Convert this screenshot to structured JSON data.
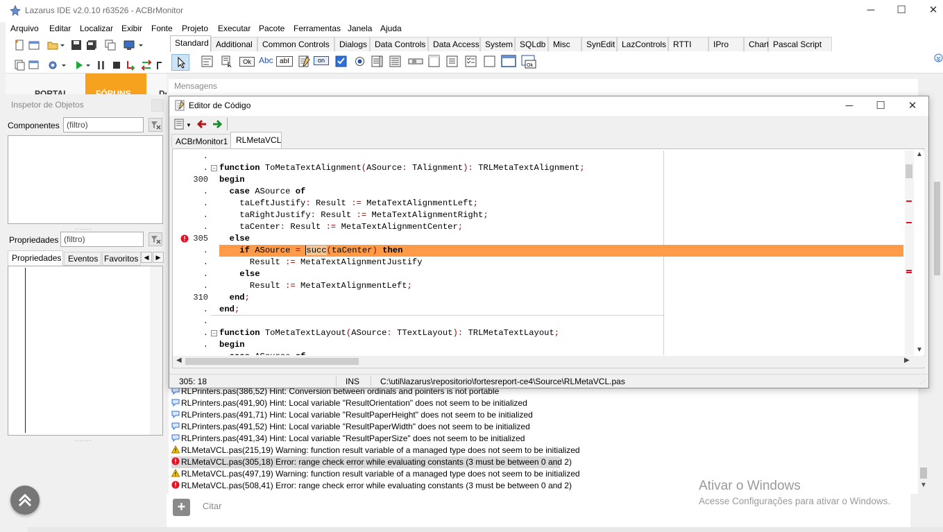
{
  "app": {
    "title": "Lazarus IDE v2.0.10 r63526 - ACBrMonitor",
    "minimize": "─",
    "maximize": "☐",
    "close": "✕"
  },
  "menu": [
    "Arquivo",
    "Editar",
    "Localizar",
    "Exibir",
    "Fonte",
    "Projeto",
    "Executar",
    "Pacote",
    "Ferramentas",
    "Janela",
    "Ajuda"
  ],
  "palette_tabs": [
    "Standard",
    "Additional",
    "Common Controls",
    "Dialogs",
    "Data Controls",
    "Data Access",
    "System",
    "SQLdb",
    "Misc",
    "SynEdit",
    "LazControls",
    "RTTI",
    "IPro",
    "Chart",
    "Pascal Script"
  ],
  "palette_components": [
    "Ok",
    "Abc",
    "abI",
    "on"
  ],
  "background": {
    "portal": "PORTAL",
    "forum": "FÓRUNS",
    "de": "De"
  },
  "inspector": {
    "title": "Inspetor de Objetos",
    "components_label": "Componentes",
    "filter_placeholder": "(filtro)",
    "props_label": "Propriedades",
    "tabs": [
      "Propriedades",
      "Eventos",
      "Favoritos"
    ]
  },
  "messages": {
    "title": "Mensagens",
    "lines": [
      {
        "type": "hint",
        "text": "RLPrinters.pas(386,52) Hint: Conversion between ordinals and pointers is not portable"
      },
      {
        "type": "hint",
        "text": "RLPrinters.pas(491,90) Hint: Local variable \"ResultOrientation\" does not seem to be initialized"
      },
      {
        "type": "hint",
        "text": "RLPrinters.pas(491,71) Hint: Local variable \"ResultPaperHeight\" does not seem to be initialized"
      },
      {
        "type": "hint",
        "text": "RLPrinters.pas(491,52) Hint: Local variable \"ResultPaperWidth\" does not seem to be initialized"
      },
      {
        "type": "hint",
        "text": "RLPrinters.pas(491,34) Hint: Local variable \"ResultPaperSize\" does not seem to be initialized"
      },
      {
        "type": "warning",
        "text": "RLMetaVCL.pas(215,19) Warning: function result variable of a managed type does not seem to be initialized"
      },
      {
        "type": "error",
        "text": "RLMetaVCL.pas(305,18) Error: range check error while evaluating constants (3 must be between 0 and 2)"
      },
      {
        "type": "warning",
        "text": "RLMetaVCL.pas(497,19) Warning: function result variable of a managed type does not seem to be initialized"
      },
      {
        "type": "error",
        "text": "RLMetaVCL.pas(508,41) Error: range check error while evaluating constants (3 must be between 0 and 2)"
      }
    ],
    "cite": "Citar"
  },
  "editor": {
    "title": "Editor de Código",
    "tabs": [
      "ACBrMonitor1",
      "RLMetaVCL"
    ],
    "active_tab": "RLMetaVCL",
    "gutter": [
      ".",
      ".",
      "300",
      ".",
      ".",
      ".",
      ".",
      "305",
      ".",
      ".",
      ".",
      ".",
      "310",
      ".",
      ".",
      ".",
      "."
    ],
    "lines": [
      "",
      "function ToMetaTextAlignment(ASource: TAlignment): TRLMetaTextAlignment;",
      "begin",
      "  case ASource of",
      "    taLeftJustify: Result := MetaTextAlignmentLeft;",
      "    taRightJustify: Result := MetaTextAlignmentRight;",
      "    taCenter: Result := MetaTextAlignmentCenter;",
      "  else",
      "    if ASource = succ(taCenter) then",
      "      Result := MetaTextAlignmentJustify",
      "    else",
      "      Result := MetaTextAlignmentLeft;",
      "  end;",
      "end;",
      "",
      "function ToMetaTextLayout(ASource: TTextLayout): TRLMetaTextLayout;",
      "begin",
      "  case ASource of"
    ],
    "status": {
      "position": "305: 18",
      "mode": "INS",
      "path": "C:\\util\\lazarus\\repositorio\\fortesreport-ce4\\Source\\RLMetaVCL.pas"
    }
  },
  "watermark": {
    "line1": "Ativar o Windows",
    "line2": "Acesse Configurações para ativar o Windows."
  },
  "colors": {
    "highlight_line": "#fd9b49",
    "error": "#e81123",
    "warning": "#e0b000",
    "hint": "#2f6fd6"
  }
}
